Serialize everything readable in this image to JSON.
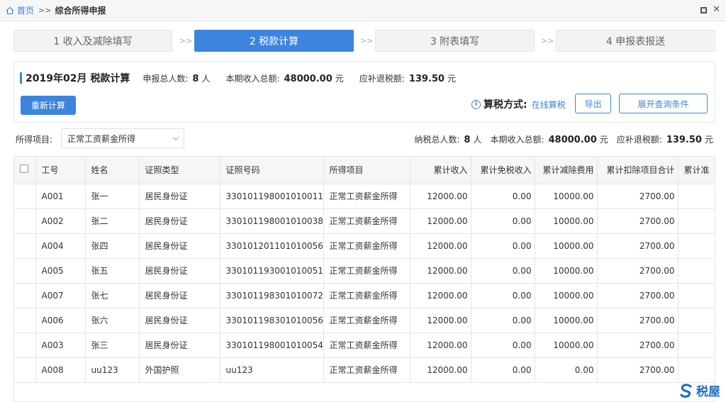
{
  "topbar": {
    "home_label": "首页",
    "separator": ">>",
    "current": "综合所得申报"
  },
  "steps": [
    {
      "label": "1 收入及减除填写",
      "active": false
    },
    {
      "label": "2 税款计算",
      "active": true
    },
    {
      "label": "3 附表填写",
      "active": false
    },
    {
      "label": "4 申报表报送",
      "active": false
    }
  ],
  "step_arrow": ">>",
  "summary": {
    "title": "2019年02月  税款计算",
    "people_label": "申报总人数:",
    "people_value": "8",
    "people_unit": "人",
    "income_label": "本期收入总额:",
    "income_value": "48000.00",
    "income_unit": "元",
    "tax_label": "应补退税额:",
    "tax_value": "139.50",
    "tax_unit": "元",
    "recalc_label": "重新计算",
    "method_label": "算税方式:",
    "method_value": "在线算税",
    "export_label": "导出",
    "expand_label": "展开查询条件"
  },
  "filter": {
    "label": "所得项目:",
    "selected": "正常工资薪金所得",
    "people_label": "纳税总人数:",
    "people_value": "8",
    "people_unit": "人",
    "income_label": "本期收入总额:",
    "income_value": "48000.00",
    "income_unit": "元",
    "tax_label": "应补退税额:",
    "tax_value": "139.50",
    "tax_unit": "元"
  },
  "table": {
    "headers": [
      "工号",
      "姓名",
      "证照类型",
      "证照号码",
      "所得项目",
      "累计收入",
      "累计免税收入",
      "累计减除费用",
      "累计扣除项目合计",
      "累计准"
    ],
    "rows": [
      [
        "A001",
        "张一",
        "居民身份证",
        "330101198001010011",
        "正常工资薪金所得",
        "12000.00",
        "0.00",
        "10000.00",
        "2700.00"
      ],
      [
        "A002",
        "张二",
        "居民身份证",
        "330101198001010038",
        "正常工资薪金所得",
        "12000.00",
        "0.00",
        "10000.00",
        "2700.00"
      ],
      [
        "A004",
        "张四",
        "居民身份证",
        "330101201101010056",
        "正常工资薪金所得",
        "12000.00",
        "0.00",
        "10000.00",
        "2700.00"
      ],
      [
        "A005",
        "张五",
        "居民身份证",
        "330101193001010051",
        "正常工资薪金所得",
        "12000.00",
        "0.00",
        "10000.00",
        "2700.00"
      ],
      [
        "A007",
        "张七",
        "居民身份证",
        "330101198301010072",
        "正常工资薪金所得",
        "12000.00",
        "0.00",
        "10000.00",
        "2700.00"
      ],
      [
        "A006",
        "张六",
        "居民身份证",
        "330101198301010056",
        "正常工资薪金所得",
        "12000.00",
        "0.00",
        "10000.00",
        "2700.00"
      ],
      [
        "A003",
        "张三",
        "居民身份证",
        "330101198001010054",
        "正常工资薪金所得",
        "12000.00",
        "0.00",
        "10000.00",
        "2700.00"
      ],
      [
        "A008",
        "uu123",
        "外国护照",
        "uu123",
        "正常工资薪金所得",
        "12000.00",
        "0.00",
        "0.00",
        "2700.00"
      ]
    ]
  },
  "watermark": "税屋",
  "colors": {
    "accent": "#3c84dd",
    "header_bg": "#f5f6f8",
    "border": "#e3e5ea"
  }
}
